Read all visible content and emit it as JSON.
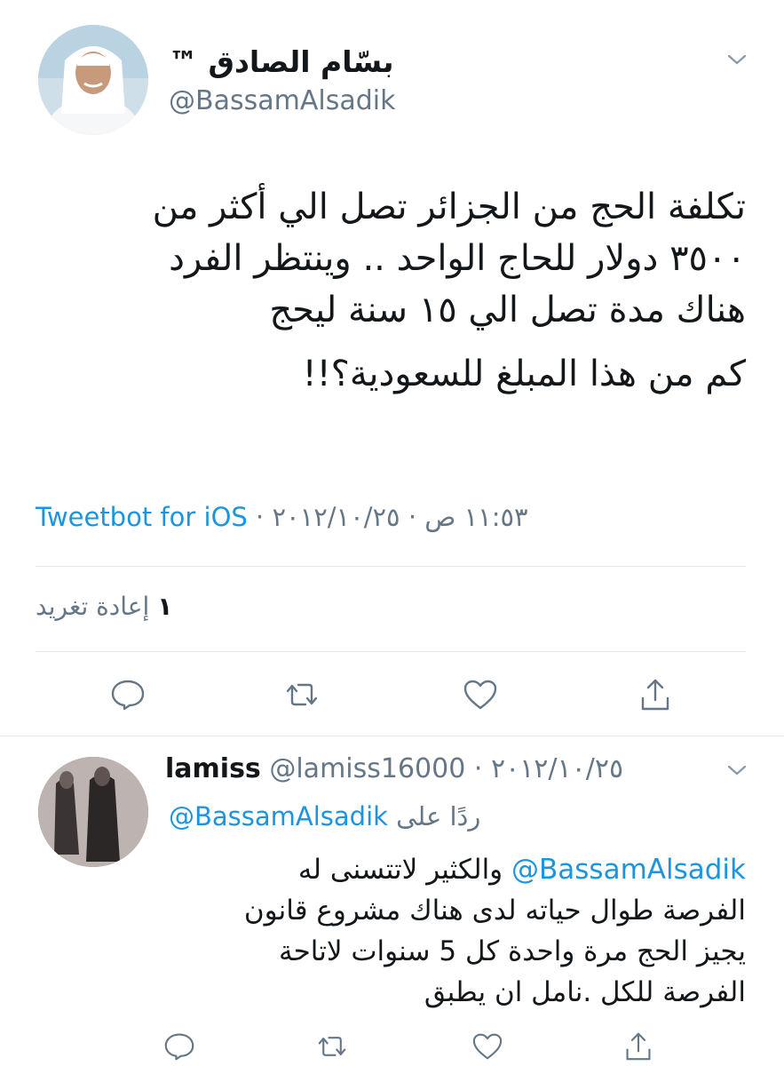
{
  "tweet": {
    "display_name": "بسّام الصادق ™",
    "handle": "@BassamAlsadik",
    "text_lines": [
      "تكلفة الحج من الجزائر تصل الي أكثر من",
      "٣٥٠٠ دولار للحاج الواحد .. وينتظر الفرد",
      "هناك مدة تصل الي ١٥ سنة ليحج"
    ],
    "text_question": "كم من هذا المبلغ للسعودية؟!!",
    "time": "١١:٥٣ ص",
    "date": "٢٠١٢/١٠/٢٥",
    "separator": "·",
    "source": "Tweetbot for iOS",
    "retweet_count": "١",
    "retweet_label": "إعادة تغريد",
    "icons": {
      "menu": "chevron-down-icon",
      "reply": "reply-icon",
      "retweet": "retweet-icon",
      "like": "heart-icon",
      "share": "share-icon"
    }
  },
  "reply": {
    "display_name": "lamiss",
    "handle": "@lamiss16000",
    "date": "٢٠١٢/١٠/٢٥",
    "separator": "·",
    "replying_to_label": "ردًا على",
    "replying_to_handle": "@BassamAlsadik",
    "mention": "@BassamAlsadik",
    "text_first": "والكثير لاتتسنى له",
    "text_lines": [
      "الفرصة طوال حياته لدى هناك مشروع قانون",
      "يجيز الحج مرة واحدة كل 5 سنوات لاتاحة",
      "الفرصة للكل .نامل ان يطبق"
    ]
  },
  "colors": {
    "link": "#1b95e0",
    "secondary": "#657786",
    "divider": "#e1e8ed",
    "text": "#14171a"
  }
}
